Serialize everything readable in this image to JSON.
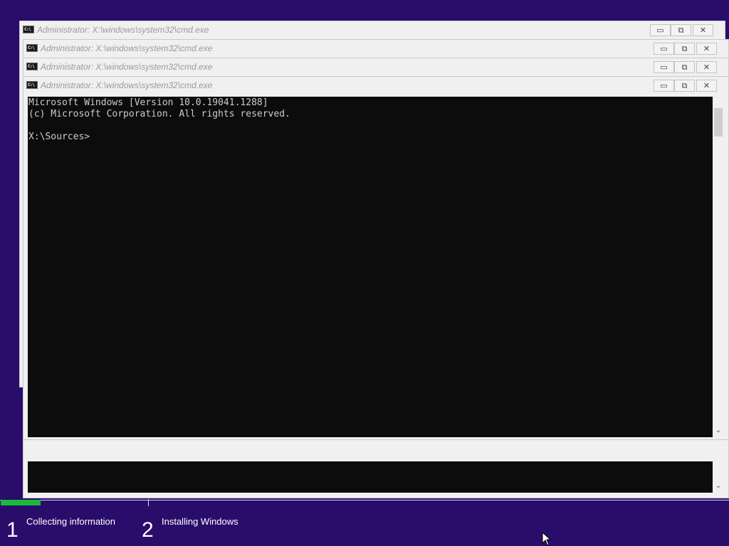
{
  "windows": [
    {
      "title": "Administrator: X:\\windows\\system32\\cmd.exe"
    },
    {
      "title": "Administrator: X:\\windows\\system32\\cmd.exe"
    },
    {
      "title": "Administrator: X:\\windows\\system32\\cmd.exe"
    },
    {
      "title": "Administrator: X:\\windows\\system32\\cmd.exe"
    }
  ],
  "icon_text": "C:\\",
  "window_buttons": {
    "minimize": "▭",
    "restore": "⧉",
    "close": "✕"
  },
  "console": {
    "lines": [
      "Microsoft Windows [Version 10.0.19041.1288]",
      "(c) Microsoft Corporation. All rights reserved.",
      "",
      "X:\\Sources>"
    ]
  },
  "scroll_arrow": "⌄",
  "setup": {
    "steps": [
      {
        "number": "1",
        "label": "Collecting information"
      },
      {
        "number": "2",
        "label": "Installing Windows"
      }
    ],
    "progress": 0.055
  },
  "colors": {
    "background": "#2a0c6b",
    "progress": "#1cb83c",
    "console_bg": "#0c0c0c",
    "console_text": "#cccccc"
  }
}
